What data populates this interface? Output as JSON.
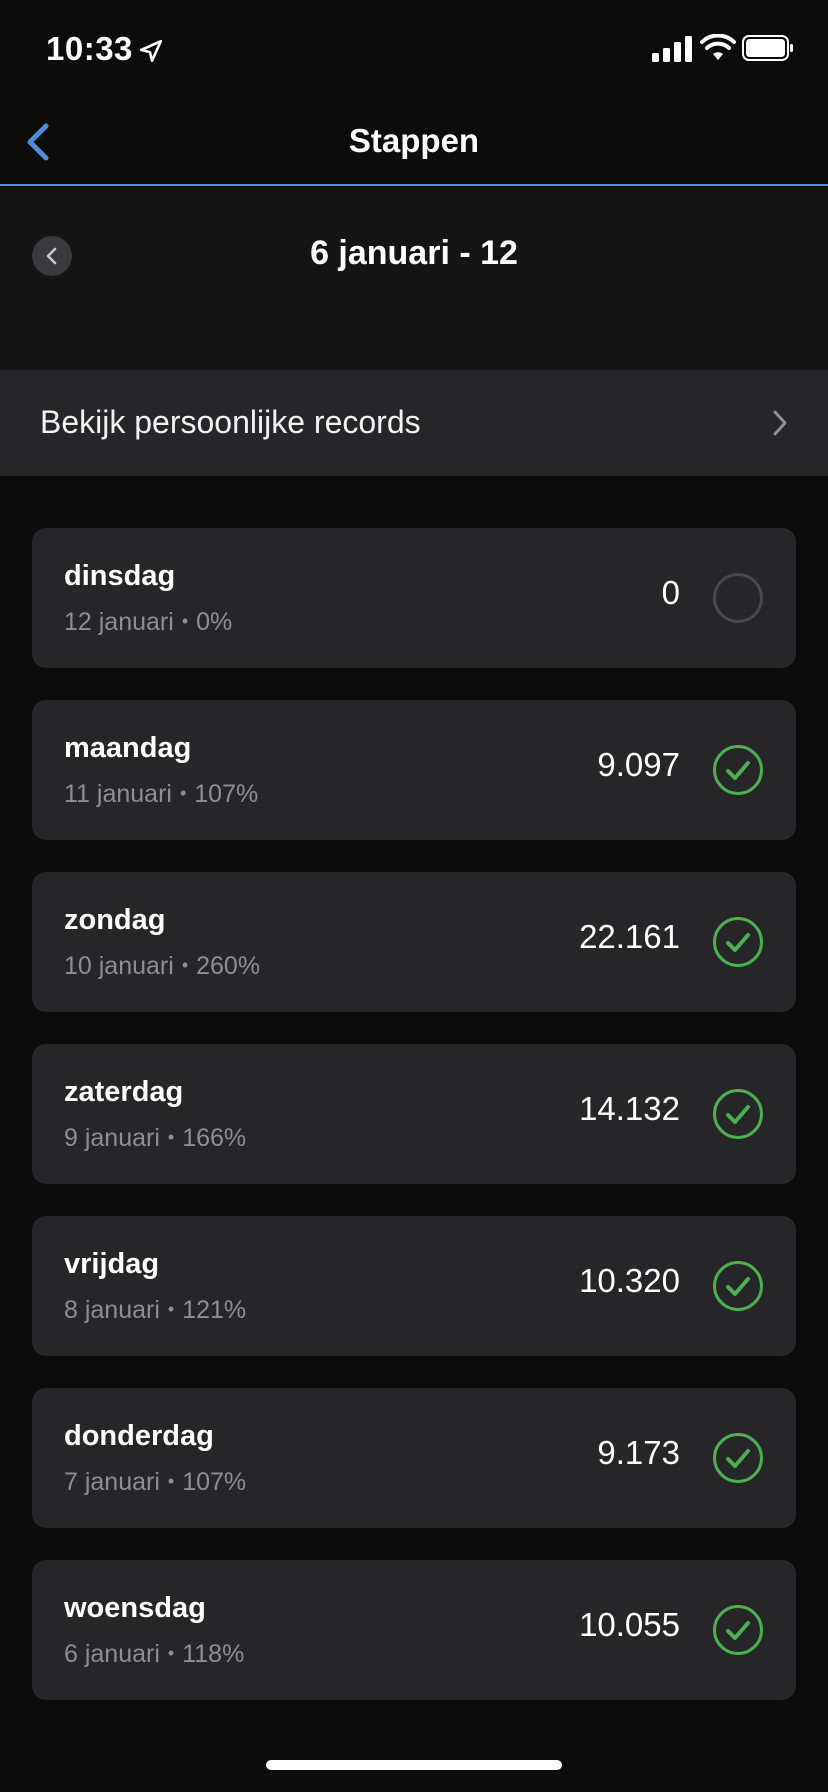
{
  "status_bar": {
    "time": "10:33",
    "icons": [
      "location-arrow-icon",
      "cellular-signal-icon",
      "wifi-icon",
      "battery-icon"
    ]
  },
  "nav": {
    "title": "Stappen",
    "back_icon": "chevron-left-icon",
    "accent_color": "#4a90d6"
  },
  "week": {
    "title": "6 januari - 12",
    "prev_icon": "chevron-left-icon"
  },
  "records": {
    "label": "Bekijk persoonlijke records",
    "icon": "chevron-right-icon"
  },
  "colors": {
    "goal_met": "#4caf50",
    "goal_not_met": "#48484a"
  },
  "days": [
    {
      "name": "dinsdag",
      "date": "12 januari",
      "percent": "0%",
      "steps": "0",
      "goal_met": false
    },
    {
      "name": "maandag",
      "date": "11 januari",
      "percent": "107%",
      "steps": "9.097",
      "goal_met": true
    },
    {
      "name": "zondag",
      "date": "10 januari",
      "percent": "260%",
      "steps": "22.161",
      "goal_met": true
    },
    {
      "name": "zaterdag",
      "date": "9 januari",
      "percent": "166%",
      "steps": "14.132",
      "goal_met": true
    },
    {
      "name": "vrijdag",
      "date": "8 januari",
      "percent": "121%",
      "steps": "10.320",
      "goal_met": true
    },
    {
      "name": "donderdag",
      "date": "7 januari",
      "percent": "107%",
      "steps": "9.173",
      "goal_met": true
    },
    {
      "name": "woensdag",
      "date": "6 januari",
      "percent": "118%",
      "steps": "10.055",
      "goal_met": true
    }
  ]
}
